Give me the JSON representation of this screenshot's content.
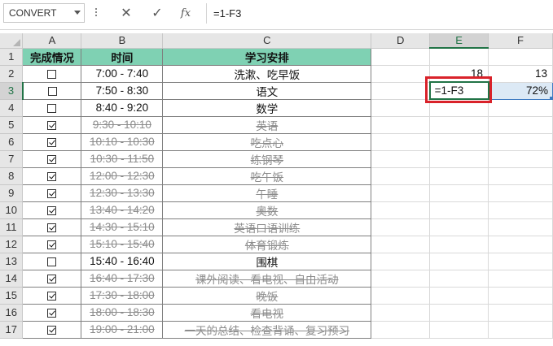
{
  "name_box": {
    "value": "CONVERT"
  },
  "formula_bar": {
    "cancel_icon": "✕",
    "enter_icon": "✓",
    "fx_label": "fx",
    "content": "=1-F3"
  },
  "columns": [
    "A",
    "B",
    "C",
    "D",
    "E",
    "F"
  ],
  "header_row": {
    "row": "1",
    "a": "完成情况",
    "b": "时间",
    "c": "学习安排"
  },
  "rows": [
    {
      "row": "2",
      "checked": false,
      "time": "7:00 - 7:40",
      "task": "洗漱、吃早饭"
    },
    {
      "row": "3",
      "checked": false,
      "time": "7:50 - 8:30",
      "task": "语文"
    },
    {
      "row": "4",
      "checked": false,
      "time": "8:40 - 9:20",
      "task": "数学"
    },
    {
      "row": "5",
      "checked": true,
      "time": "9:30 - 10:10",
      "task": "英语"
    },
    {
      "row": "6",
      "checked": true,
      "time": "10:10 - 10:30",
      "task": "吃点心"
    },
    {
      "row": "7",
      "checked": true,
      "time": "10:30 - 11:50",
      "task": "练钢琴"
    },
    {
      "row": "8",
      "checked": true,
      "time": "12:00 - 12:30",
      "task": "吃午饭"
    },
    {
      "row": "9",
      "checked": true,
      "time": "12:30 - 13:30",
      "task": "午睡"
    },
    {
      "row": "10",
      "checked": true,
      "time": "13:40 - 14:20",
      "task": "奥数"
    },
    {
      "row": "11",
      "checked": true,
      "time": "14:30 - 15:10",
      "task": "英语口语训练"
    },
    {
      "row": "12",
      "checked": true,
      "time": "15:10 - 15:40",
      "task": "体育锻炼"
    },
    {
      "row": "13",
      "checked": false,
      "time": "15:40 - 16:40",
      "task": "围棋"
    },
    {
      "row": "14",
      "checked": true,
      "time": "16:40 - 17:30",
      "task": "课外阅读、看电视、自由活动"
    },
    {
      "row": "15",
      "checked": true,
      "time": "17:30 - 18:00",
      "task": "晚饭"
    },
    {
      "row": "16",
      "checked": true,
      "time": "18:00 - 18:30",
      "task": "看电视"
    },
    {
      "row": "17",
      "checked": true,
      "time": "19:00 - 21:00",
      "task": "一天的总结、检查背诵、复习预习"
    }
  ],
  "cells": {
    "E2": "18",
    "F2": "13",
    "E3": "=1-F3",
    "F3": "72%"
  },
  "colors": {
    "header_fill": "#7fd1b3",
    "selection": "#217346",
    "highlight_box": "#d9222a",
    "range_fill": "#dce9f5"
  }
}
